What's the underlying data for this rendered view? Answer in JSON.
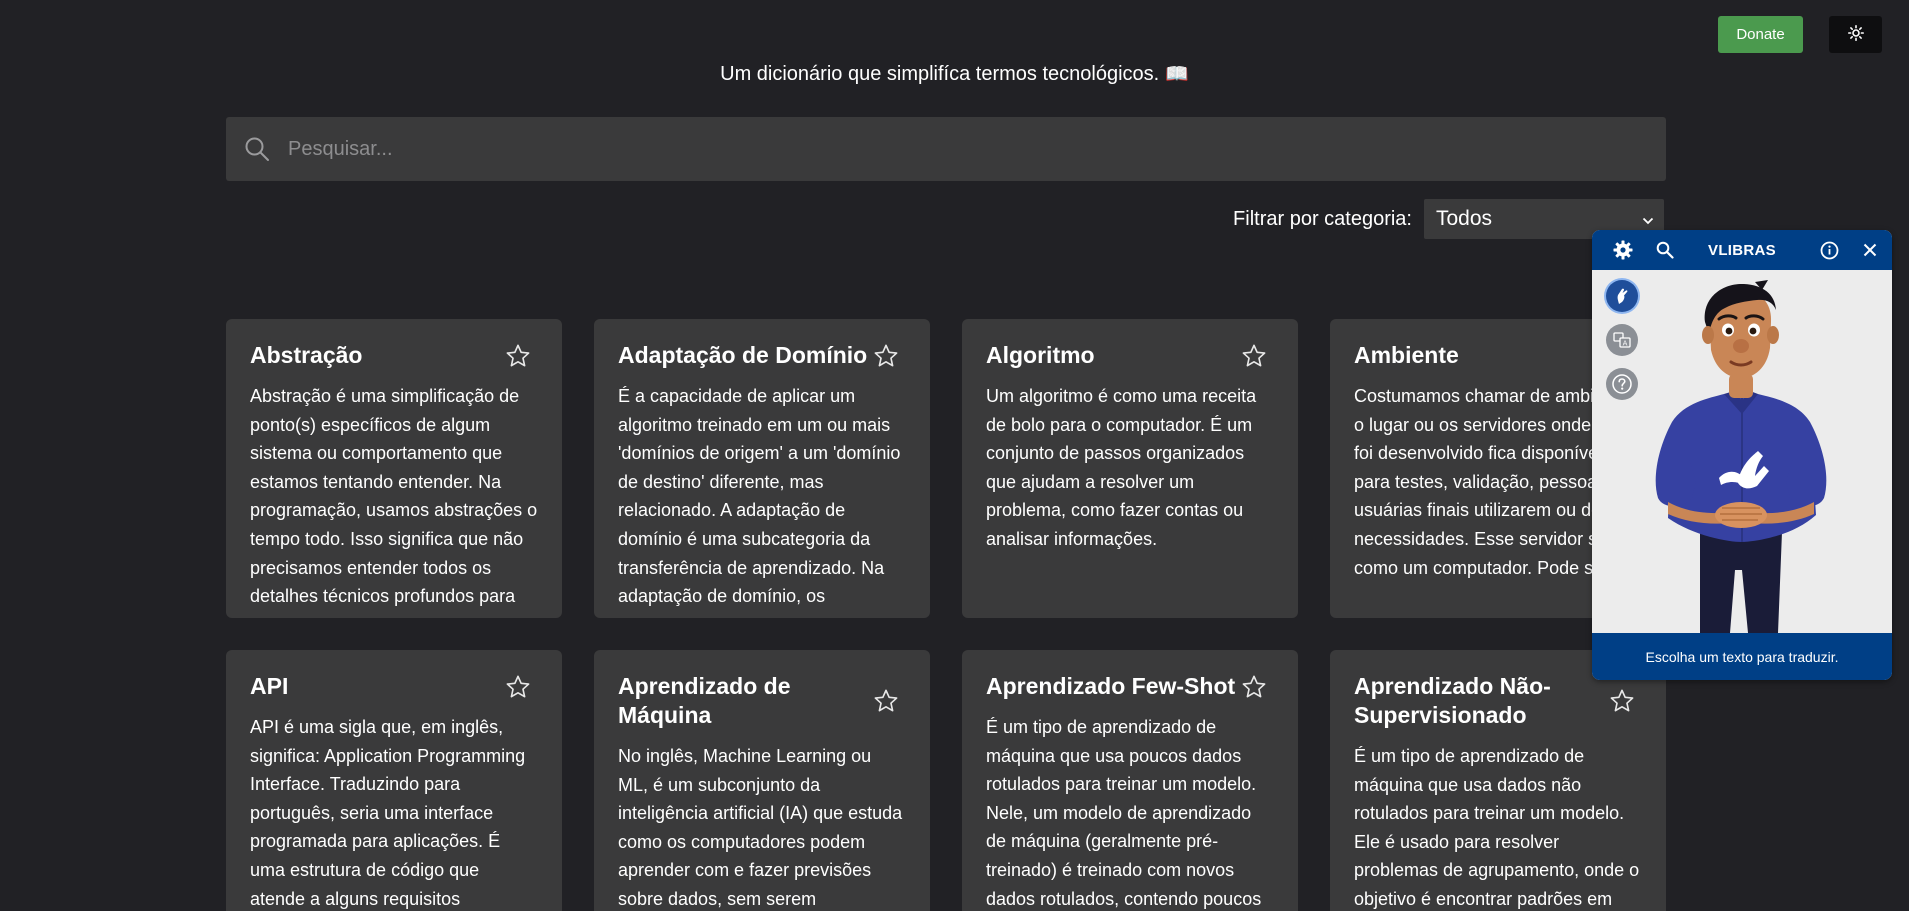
{
  "header": {
    "donate_label": "Donate",
    "theme_icon": "sun-icon",
    "tagline": "Um dicionário que simplifíca termos tecnológicos.",
    "tagline_emoji": "📖"
  },
  "search": {
    "placeholder": "Pesquisar...",
    "icon": "search-icon"
  },
  "filter": {
    "label": "Filtrar por categoria:",
    "selected": "Todos"
  },
  "cards": [
    {
      "title": "Abstração",
      "text": "Abstração é uma simplificação de ponto(s) específicos de algum sistema ou comportamento que estamos tentando entender. Na programação, usamos abstrações o tempo todo. Isso significa que não precisamos entender todos os detalhes técnicos profundos para"
    },
    {
      "title": "Adaptação de Domínio",
      "text": "É a capacidade de aplicar um algoritmo treinado em um ou mais 'domínios de origem' a um 'domínio de destino' diferente, mas relacionado. A adaptação de domínio é uma subcategoria da transferência de aprendizado. Na adaptação de domínio, os"
    },
    {
      "title": "Algoritmo",
      "text": "Um algoritmo é como uma receita de bolo para o computador. É um conjunto de passos organizados que ajudam a resolver um problema, como fazer contas ou analisar informações."
    },
    {
      "title": "Ambiente",
      "text": "Costumamos chamar de ambiente o lugar ou os servidores onde o que foi desenvolvido fica disponível para testes, validação, pessoas usuárias finais utilizarem ou demais necessidades. Esse servidor seria como um computador. Pode ser um"
    },
    {
      "title": "API",
      "text": "API é uma sigla que, em inglês, significa: Application Programming Interface. Traduzindo para português, seria uma interface programada para aplicações. É uma estrutura de código que atende a alguns requisitos"
    },
    {
      "title": "Aprendizado de Máquina",
      "text": "No inglês, Machine Learning ou ML, é um subconjunto da inteligência artificial (IA) que estuda como os computadores podem aprender com e fazer previsões sobre dados, sem serem"
    },
    {
      "title": "Aprendizado Few-Shot",
      "text": "É um tipo de aprendizado de máquina que usa poucos dados rotulados para treinar um modelo. Nele, um modelo de aprendizado de máquina (geralmente pré-treinado) é treinado com novos dados rotulados, contendo poucos"
    },
    {
      "title": "Aprendizado Não-Supervisionado",
      "text": "É um tipo de aprendizado de máquina que usa dados não rotulados para treinar um modelo. Ele é usado para resolver problemas de agrupamento, onde o objetivo é encontrar padrões em"
    }
  ],
  "vlibras": {
    "title": "VLIBRAS",
    "footer": "Escolha um texto para traduzir.",
    "header_icons": [
      "gear-icon",
      "search-icon",
      "info-icon",
      "close-icon"
    ],
    "side_icons": [
      "hand-icon",
      "translate-icon",
      "help-icon"
    ],
    "colors": {
      "primary": "#003f86",
      "body": "#ececec"
    }
  },
  "colors": {
    "background": "#212125",
    "card": "#3a3a3b",
    "donate": "#4b9a4e"
  }
}
